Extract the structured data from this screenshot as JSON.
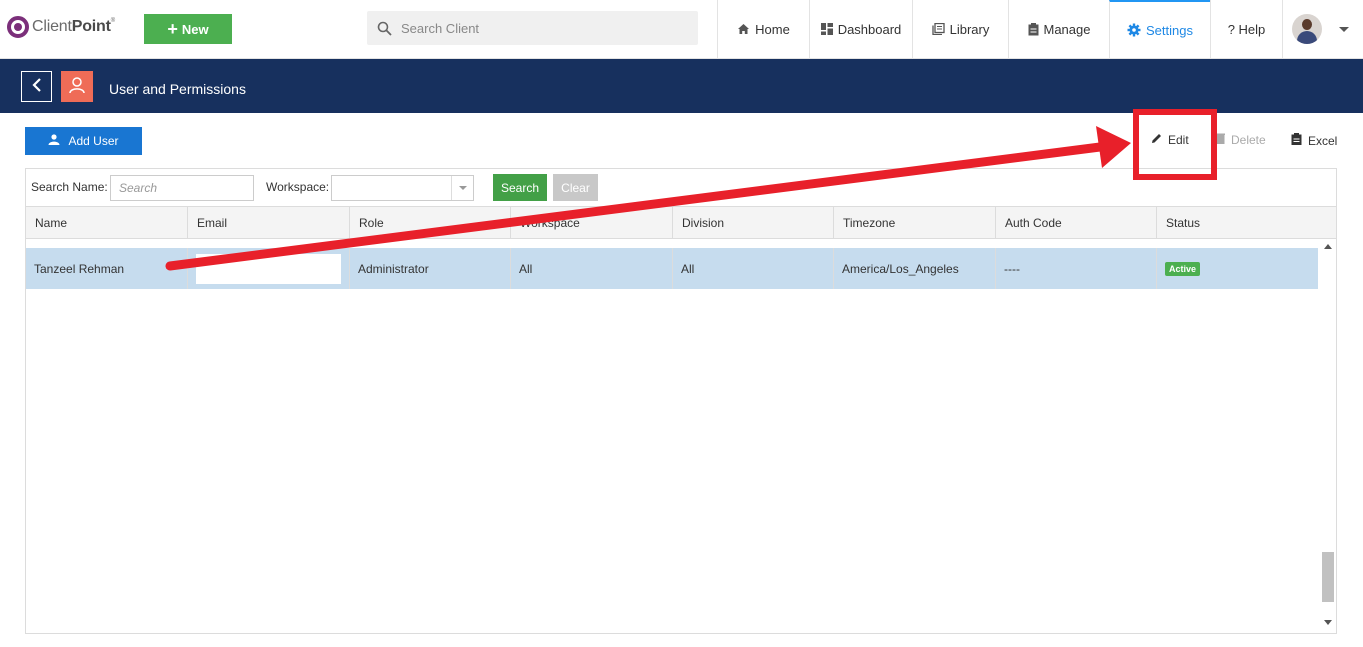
{
  "header": {
    "logo_light": "Client",
    "logo_bold": "Point",
    "logo_reg": "®",
    "new_button": "New",
    "search_placeholder": "Search Client",
    "nav": [
      {
        "label": "Home",
        "icon": "home-icon"
      },
      {
        "label": "Dashboard",
        "icon": "dashboard-icon"
      },
      {
        "label": "Library",
        "icon": "library-icon"
      },
      {
        "label": "Manage",
        "icon": "manage-icon"
      },
      {
        "label": "Settings",
        "icon": "gear-icon",
        "active": true
      },
      {
        "label": "? Help",
        "icon": "help-icon"
      }
    ]
  },
  "titlebar": {
    "title": "User and Permissions"
  },
  "toolbar": {
    "add_user": "Add User",
    "edit": "Edit",
    "delete": "Delete",
    "excel": "Excel"
  },
  "filter": {
    "search_name_label": "Search Name:",
    "search_name_placeholder": "Search",
    "workspace_label": "Workspace:",
    "workspace_value": "",
    "search_button": "Search",
    "clear_button": "Clear"
  },
  "table": {
    "columns": [
      "Name",
      "Email",
      "Role",
      "Workspace",
      "Division",
      "Timezone",
      "Auth Code",
      "Status"
    ],
    "rows": [
      {
        "name": "Tanzeel Rehman",
        "email": "",
        "role": "Administrator",
        "workspace": "All",
        "division": "All",
        "timezone": "America/Los_Angeles",
        "auth_code": "----",
        "status": "Active"
      }
    ]
  },
  "colors": {
    "nav_bar": "#17305e",
    "accent_blue": "#1976d2",
    "new_green": "#4caf50",
    "selected_row": "#c6dcee",
    "annotation_red": "#e8202a"
  }
}
